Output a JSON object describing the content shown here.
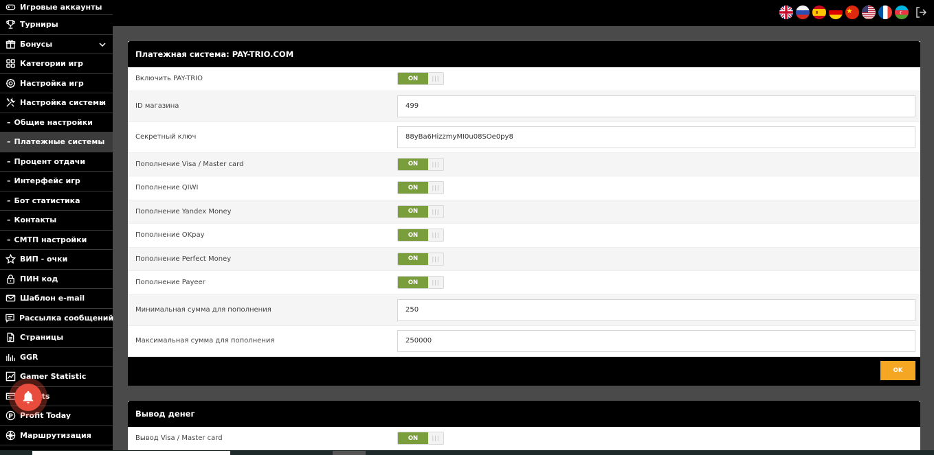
{
  "sidebar": {
    "items": [
      {
        "label": "Игровые аккаунты",
        "icon": "gamepad-icon"
      },
      {
        "label": "Турниры",
        "icon": "trophy-icon"
      },
      {
        "label": "Бонусы",
        "icon": "gift-icon",
        "chevron": "down"
      },
      {
        "label": "Категории игр",
        "icon": "grid-icon"
      },
      {
        "label": "Настройка игр",
        "icon": "gear-icon"
      },
      {
        "label": "Настройка системы",
        "icon": "tools-icon",
        "chevron": "up"
      },
      {
        "label": "Общие настройки",
        "sub": true
      },
      {
        "label": "Платежные системы",
        "sub": true,
        "active": true
      },
      {
        "label": "Процент отдачи",
        "sub": true
      },
      {
        "label": "Интерфейс игр",
        "sub": true
      },
      {
        "label": "Бот статистика",
        "sub": true
      },
      {
        "label": "Контакты",
        "sub": true
      },
      {
        "label": "СМТП настройки",
        "sub": true
      },
      {
        "label": "ВИП - очки",
        "icon": "star-icon"
      },
      {
        "label": "ПИН код",
        "icon": "lock-icon"
      },
      {
        "label": "Шаблон e-mail",
        "icon": "mail-icon"
      },
      {
        "label": "Рассылка сообщений",
        "icon": "message-icon"
      },
      {
        "label": "Страницы",
        "icon": "document-icon"
      },
      {
        "label": "GGR",
        "icon": "ggr-icon"
      },
      {
        "label": "Gamer Statistic",
        "icon": "chart-icon"
      },
      {
        "label": "Agents",
        "icon": "agents-icon"
      },
      {
        "label": "Profit Today",
        "icon": "profit-icon"
      },
      {
        "label": "Маршрутизация",
        "icon": "routing-icon"
      }
    ]
  },
  "header": {
    "flags": [
      "uk-flag-icon",
      "russia-flag-icon",
      "spain-flag-icon",
      "germany-flag-icon",
      "china-flag-icon",
      "usa-flag-icon",
      "france-flag-icon",
      "azerbaijan-flag-icon"
    ],
    "logout_icon": "logout-icon"
  },
  "payment_card": {
    "title": "Платежная система: PAY-TRIO.COM",
    "rows": [
      {
        "label": "Включить PAY-TRIO",
        "type": "toggle",
        "value": "ON"
      },
      {
        "label": "ID магазина",
        "type": "input",
        "value": "499"
      },
      {
        "label": "Секретный ключ",
        "type": "input",
        "value": "88yBa6HizzmyMI0u08SOe0py8"
      },
      {
        "label": "Пополнение Visa / Master card",
        "type": "toggle",
        "value": "ON"
      },
      {
        "label": "Пополнение QIWI",
        "type": "toggle",
        "value": "ON"
      },
      {
        "label": "Пополнение Yandex Money",
        "type": "toggle",
        "value": "ON"
      },
      {
        "label": "Пополнение OKpay",
        "type": "toggle",
        "value": "ON"
      },
      {
        "label": "Пополнение Perfect Money",
        "type": "toggle",
        "value": "ON"
      },
      {
        "label": "Пополнение Payeer",
        "type": "toggle",
        "value": "ON"
      },
      {
        "label": "Минимальная сумма для пополнения",
        "type": "input",
        "value": "250"
      },
      {
        "label": "Максимальная сумма для пополнения",
        "type": "input",
        "value": "250000"
      }
    ],
    "ok_label": "OK"
  },
  "withdraw_card": {
    "title": "Вывод денег",
    "rows": [
      {
        "label": "Вывод Visa / Master card",
        "type": "toggle",
        "value": "ON"
      }
    ]
  },
  "colors": {
    "accent_green": "#7a9e3b",
    "ok_orange": "#f5a623",
    "bell_red": "#e84c3d"
  }
}
